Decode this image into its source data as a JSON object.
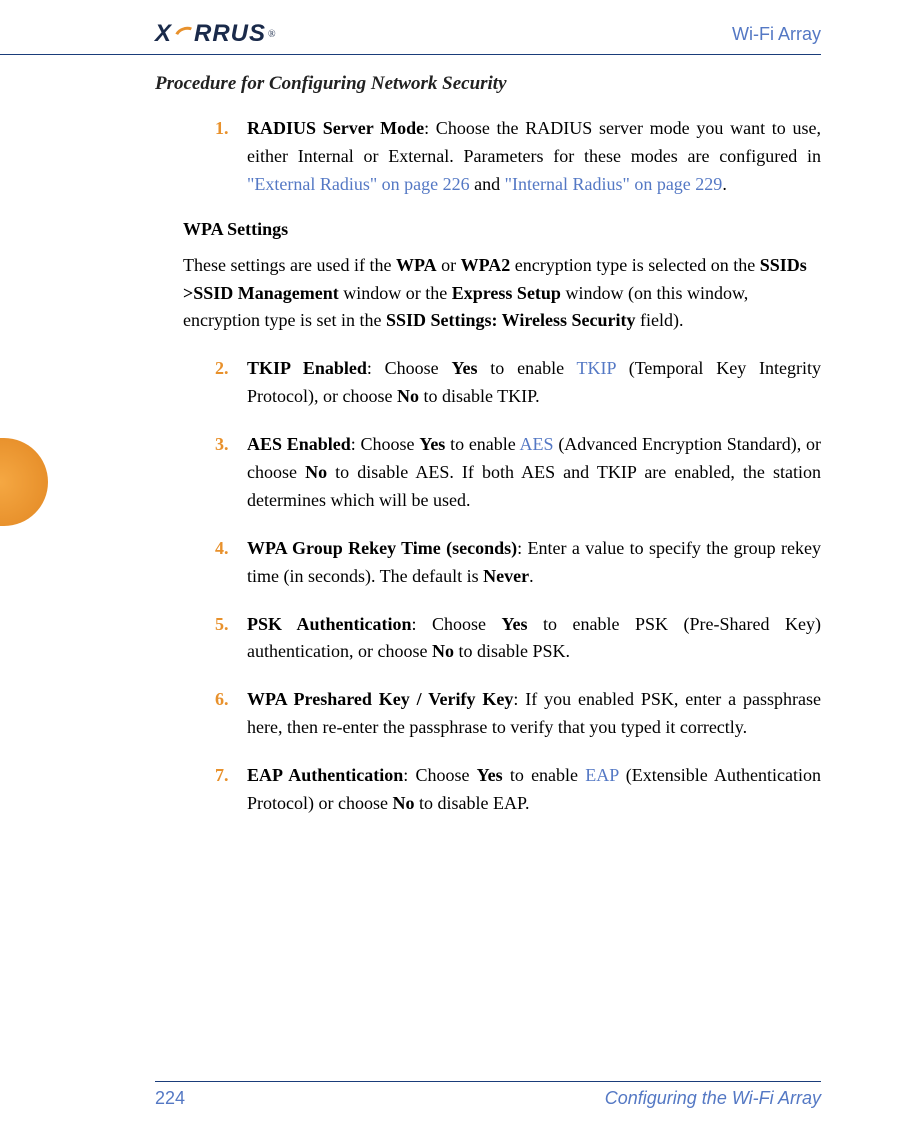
{
  "header": {
    "logo_text": "X   RRUS",
    "product": "Wi-Fi Array"
  },
  "procedure_title": "Procedure for Configuring Network Security",
  "items": {
    "i1": {
      "num": "1.",
      "bold": "RADIUS Server Mode",
      "t1": ": Choose the RADIUS server mode you want to use, either Internal or External. Parameters for these modes are configured in ",
      "link1": "\"External Radius\" on page 226",
      "t2": " and ",
      "link2": "\"Internal Radius\" on page 229",
      "t3": "."
    },
    "wpa_heading": "WPA Settings",
    "wpa_para": {
      "t1": "These settings are used if the ",
      "b1": "WPA",
      "t2": " or ",
      "b2": "WPA2",
      "t3": " encryption type is selected on the ",
      "b3": "SSIDs >SSID Management",
      "t4": " window or the ",
      "b4": "Express Setup",
      "t5": " window (on this window, encryption type is set in the ",
      "b5": "SSID Settings: Wireless Security",
      "t6": " field)."
    },
    "i2": {
      "num": "2.",
      "bold": "TKIP Enabled",
      "t1": ": Choose ",
      "b1": "Yes",
      "t2": " to enable ",
      "link1": "TKIP",
      "t3": " (Temporal Key Integrity Protocol), or choose ",
      "b2": "No",
      "t4": " to disable TKIP."
    },
    "i3": {
      "num": "3.",
      "bold": "AES Enabled",
      "t1": ": Choose ",
      "b1": "Yes",
      "t2": " to enable ",
      "link1": "AES",
      "t3": " (Advanced Encryption Standard), or choose ",
      "b2": "No",
      "t4": " to disable AES. If both AES and TKIP are enabled, the station determines which will be used."
    },
    "i4": {
      "num": "4.",
      "bold": "WPA Group Rekey Time (seconds)",
      "t1": ": Enter a value to specify the group rekey time (in seconds). The default is ",
      "b1": "Never",
      "t2": "."
    },
    "i5": {
      "num": "5.",
      "bold": "PSK Authentication",
      "t1": ": Choose ",
      "b1": "Yes",
      "t2": " to enable PSK (Pre-Shared Key) authentication, or choose ",
      "b2": "No",
      "t3": " to disable PSK."
    },
    "i6": {
      "num": "6.",
      "bold": "WPA Preshared Key / Verify Key",
      "t1": ": If you enabled PSK, enter a passphrase here, then re-enter the passphrase to verify that you typed it correctly."
    },
    "i7": {
      "num": "7.",
      "bold": "EAP Authentication",
      "t1": ": Choose ",
      "b1": "Yes",
      "t2": " to enable ",
      "link1": "EAP",
      "t3": " (Extensible Authentication Protocol) or choose ",
      "b2": "No",
      "t4": " to disable EAP."
    }
  },
  "footer": {
    "page": "224",
    "section": "Configuring the Wi-Fi Array"
  }
}
